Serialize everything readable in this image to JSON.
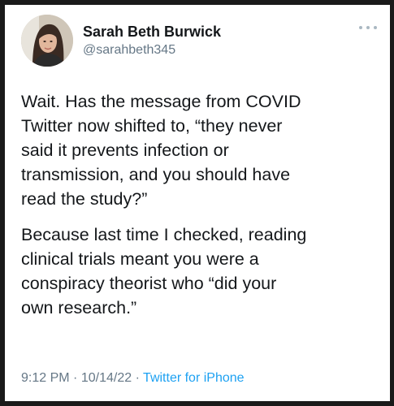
{
  "author": {
    "display_name": "Sarah Beth Burwick",
    "handle": "@sarahbeth345",
    "avatar_icon": "profile-photo"
  },
  "tweet": {
    "paragraphs": [
      "Wait. Has the message from COVID\nTwitter now shifted to, “they never\nsaid it prevents infection or\ntransmission, and you should have\nread the study?”",
      "Because last time I checked, reading\nclinical trials meant you were a\nconspiracy theorist who “did your\nown research.”"
    ]
  },
  "meta": {
    "time": "9:12 PM",
    "separator": "·",
    "date": "10/14/22",
    "source": "Twitter for iPhone"
  },
  "colors": {
    "text": "#14171a",
    "muted": "#657786",
    "link": "#1da1f2",
    "background": "#ffffff"
  }
}
